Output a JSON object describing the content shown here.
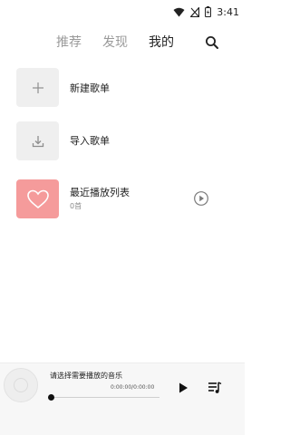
{
  "status": {
    "time": "3:41",
    "icons": [
      "wifi-icon",
      "signal-icon",
      "battery-icon"
    ]
  },
  "tabs": [
    {
      "label": "推荐",
      "active": false
    },
    {
      "label": "发现",
      "active": false
    },
    {
      "label": "我的",
      "active": true
    }
  ],
  "header": {
    "search_icon": "search-icon"
  },
  "items": [
    {
      "title": "新建歌单",
      "icon": "plus-icon"
    },
    {
      "title": "导入歌单",
      "icon": "import-icon"
    },
    {
      "title": "最近播放列表",
      "subtitle": "0首",
      "icon": "heart-icon",
      "action_icon": "play-circle-icon"
    }
  ],
  "player": {
    "title": "请选择需要播放的音乐",
    "time": "0:00:00/0:00:00",
    "progress": 0,
    "controls": [
      "play-icon",
      "playlist-icon"
    ]
  },
  "colors": {
    "accent": "#f59b9b",
    "tile_bg": "#efefef",
    "player_bg": "#f7f7f7",
    "muted_text": "#9a9a9a"
  }
}
